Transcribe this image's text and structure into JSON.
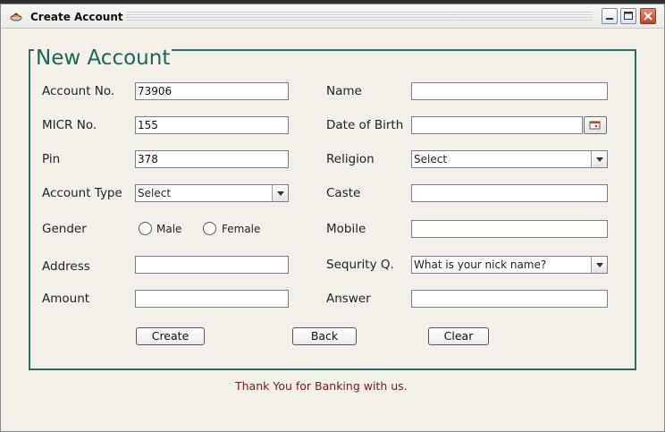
{
  "window": {
    "title": "Create Account"
  },
  "group": {
    "title": "New Account"
  },
  "left": {
    "account_no": {
      "label": "Account No.",
      "value": "73906"
    },
    "micr_no": {
      "label": "MICR No.",
      "value": "155"
    },
    "pin": {
      "label": "Pin",
      "value": "378"
    },
    "account_type": {
      "label": "Account Type",
      "selected": "Select"
    },
    "gender": {
      "label": "Gender",
      "option_male": "Male",
      "option_female": "Female"
    },
    "address": {
      "label": "Address",
      "value": ""
    },
    "amount": {
      "label": "Amount",
      "value": ""
    }
  },
  "right": {
    "name": {
      "label": "Name",
      "value": ""
    },
    "dob": {
      "label": "Date of Birth",
      "value": ""
    },
    "religion": {
      "label": "Religion",
      "selected": "Select"
    },
    "caste": {
      "label": "Caste",
      "value": ""
    },
    "mobile": {
      "label": "Mobile",
      "value": ""
    },
    "security_q": {
      "label": "Sequrity Q.",
      "selected": "What is your nick name?"
    },
    "answer": {
      "label": "Answer",
      "value": ""
    }
  },
  "buttons": {
    "create": "Create",
    "back": "Back",
    "clear": "Clear"
  },
  "footer": {
    "message": "Thank You for Banking with us."
  },
  "icons": [
    "app-icon",
    "minimize-icon",
    "maximize-icon",
    "close-icon",
    "calendar-icon",
    "chevron-down-icon"
  ],
  "colors": {
    "group_border": "#2a6e63",
    "group_title": "#1f6650",
    "footer_text": "#7a1a1a"
  }
}
